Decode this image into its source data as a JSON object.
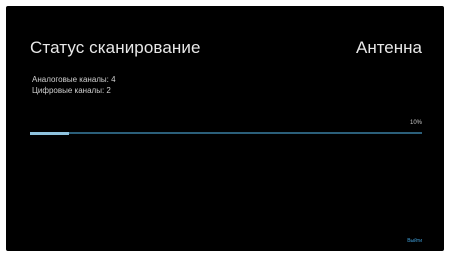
{
  "header": {
    "title": "Статус сканирование",
    "source": "Антенна"
  },
  "scan": {
    "analog_label": "Аналоговые каналы: 4",
    "digital_label": "Цифровые каналы: 2",
    "analog_count": 4,
    "digital_count": 2,
    "progress_percent": 10,
    "progress_label": "10%"
  },
  "footer": {
    "exit_label": "Выйти"
  },
  "colors": {
    "background": "#000000",
    "text": "#e8e8e8",
    "progress_track": "#2b5f7a",
    "progress_fill": "#8fc3de",
    "accent": "#3f9fd9"
  }
}
